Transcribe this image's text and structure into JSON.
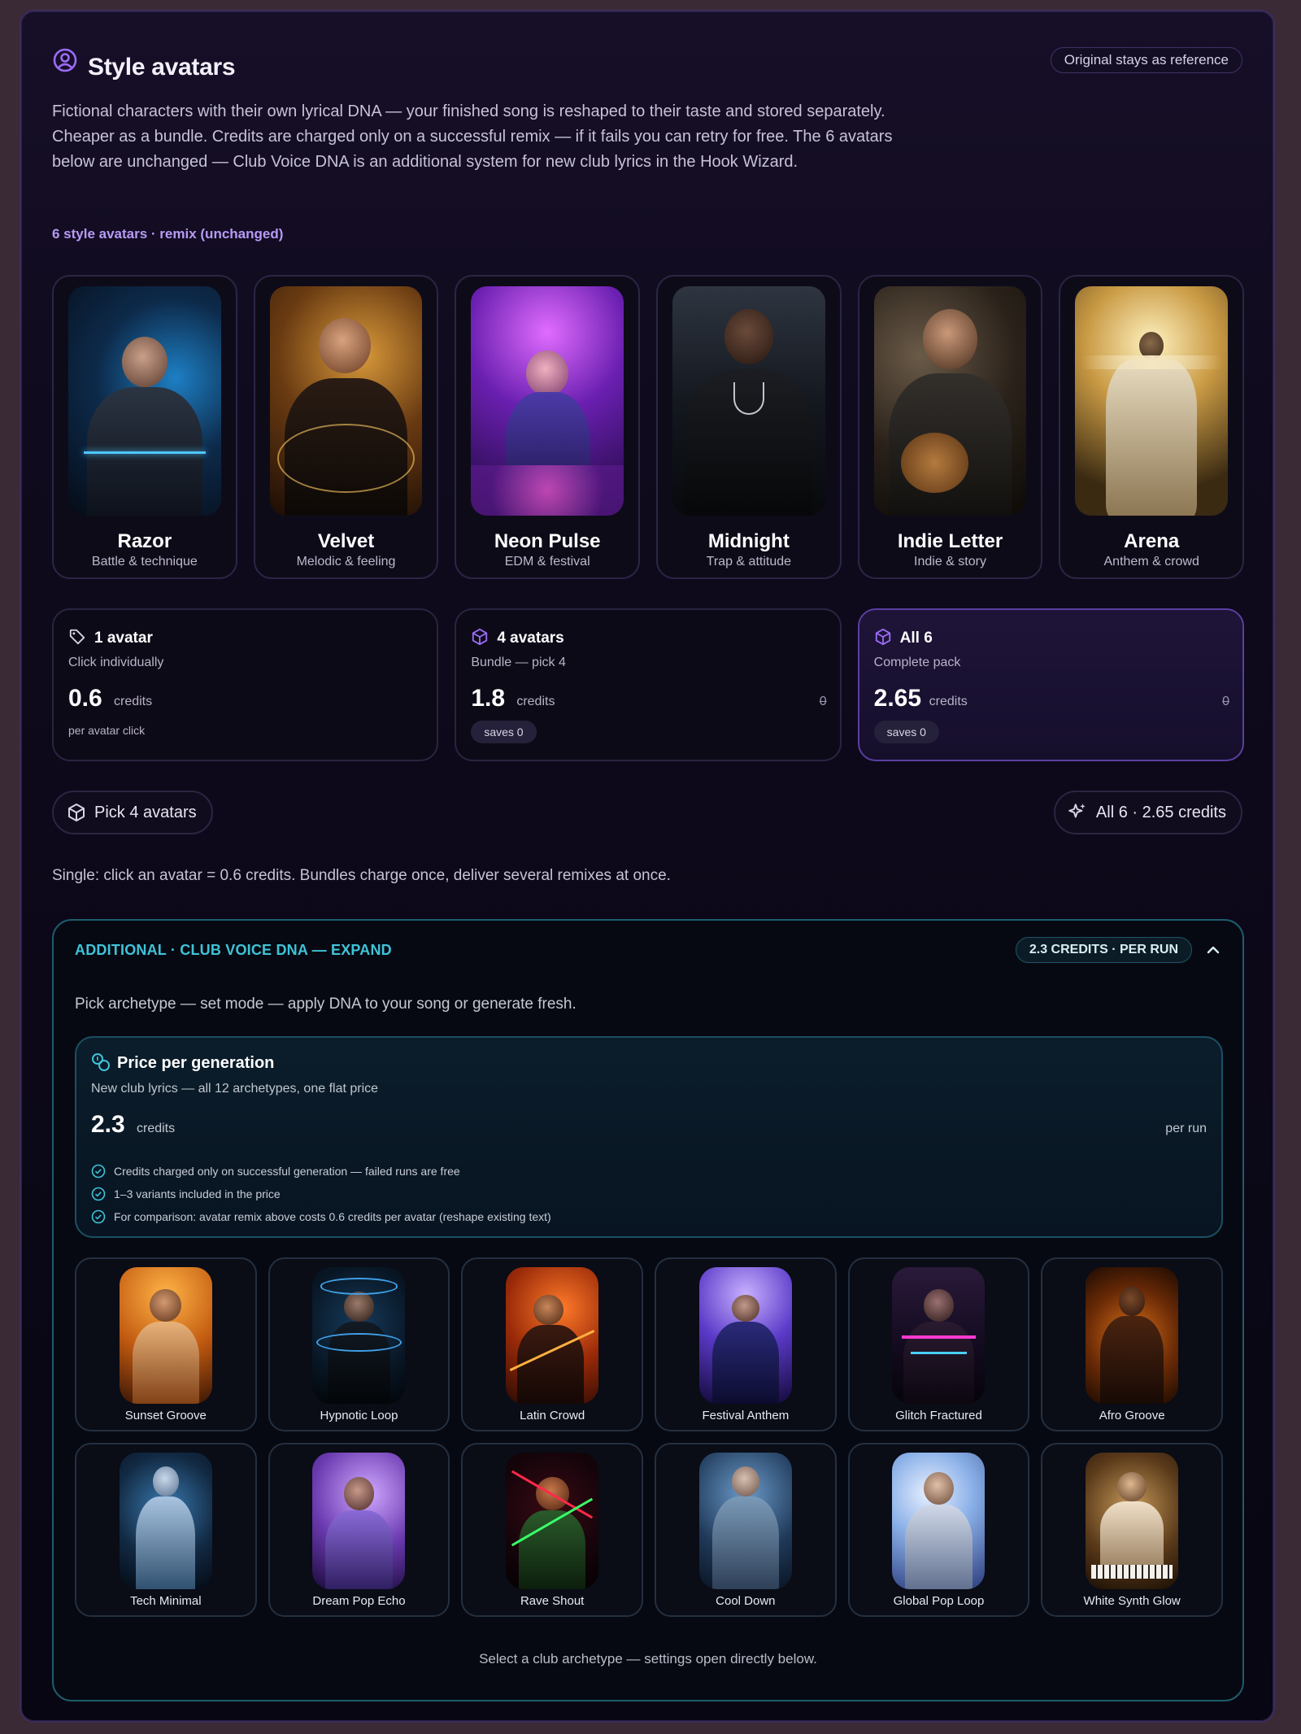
{
  "header": {
    "icon": "user-circle-icon",
    "title": "Style avatars",
    "reference_pill": "Original stays as reference",
    "intro": "Fictional characters with their own lyrical DNA — your finished song is reshaped to their taste and stored separately. Cheaper as a bundle. Credits are charged only on a successful remix — if it fails you can retry for free. The 6 avatars below are unchanged — Club Voice DNA is an additional system for new club lyrics in the Hook Wizard."
  },
  "section_label": "6 style avatars · remix (unchanged)",
  "avatars": [
    {
      "name": "Razor",
      "style": "Battle & technique"
    },
    {
      "name": "Velvet",
      "style": "Melodic & feeling"
    },
    {
      "name": "Neon Pulse",
      "style": "EDM & festival"
    },
    {
      "name": "Midnight",
      "style": "Trap & attitude"
    },
    {
      "name": "Indie Letter",
      "style": "Indie & story"
    },
    {
      "name": "Arena",
      "style": "Anthem & crowd"
    }
  ],
  "pricing": [
    {
      "icon": "tag-icon",
      "title": "1 avatar",
      "subtitle": "Click individually",
      "value": "0.6",
      "unit": "credits",
      "footer": "per avatar click"
    },
    {
      "icon": "package-icon",
      "title": "4 avatars",
      "subtitle": "Bundle — pick 4",
      "value": "1.8",
      "unit": "credits",
      "strike": "0",
      "badge": "saves 0"
    },
    {
      "icon": "package-icon",
      "title": "All 6",
      "subtitle": "Complete pack",
      "value": "2.65",
      "unit": "credits",
      "strike": "0",
      "badge": "saves 0"
    }
  ],
  "actions": {
    "bundle_button": "Pick 4 avatars",
    "all_button": "All 6 · 2.65 credits"
  },
  "single_note": "Single: click an avatar = 0.6 credits. Bundles charge once, deliver several remixes at once.",
  "club": {
    "title": "ADDITIONAL · CLUB VOICE DNA — EXPAND",
    "pill": "2.3 CREDITS · PER RUN",
    "description": "Pick archetype — set mode — apply DNA to your song or generate fresh.",
    "price": {
      "title": "Price per generation",
      "subtitle": "New club lyrics — all 12 archetypes, one flat price",
      "value": "2.3",
      "unit": "credits",
      "per": "per run",
      "bullets": [
        "Credits charged only on successful generation — failed runs are free",
        "1–3 variants included in the price",
        "For comparison: avatar remix above costs 0.6 credits per avatar (reshape existing text)"
      ]
    },
    "archetypes": [
      "Sunset Groove",
      "Hypnotic Loop",
      "Latin Crowd",
      "Festival Anthem",
      "Glitch Fractured",
      "Afro Groove",
      "Tech Minimal",
      "Dream Pop Echo",
      "Rave Shout",
      "Cool Down",
      "Global Pop Loop",
      "White Synth Glow"
    ],
    "footer": "Select a club archetype — settings open directly below."
  },
  "colors": {
    "accent_purple": "#b79af5",
    "accent_cyan": "#3fc3d8",
    "panel_bg": "#0f0a1d"
  }
}
